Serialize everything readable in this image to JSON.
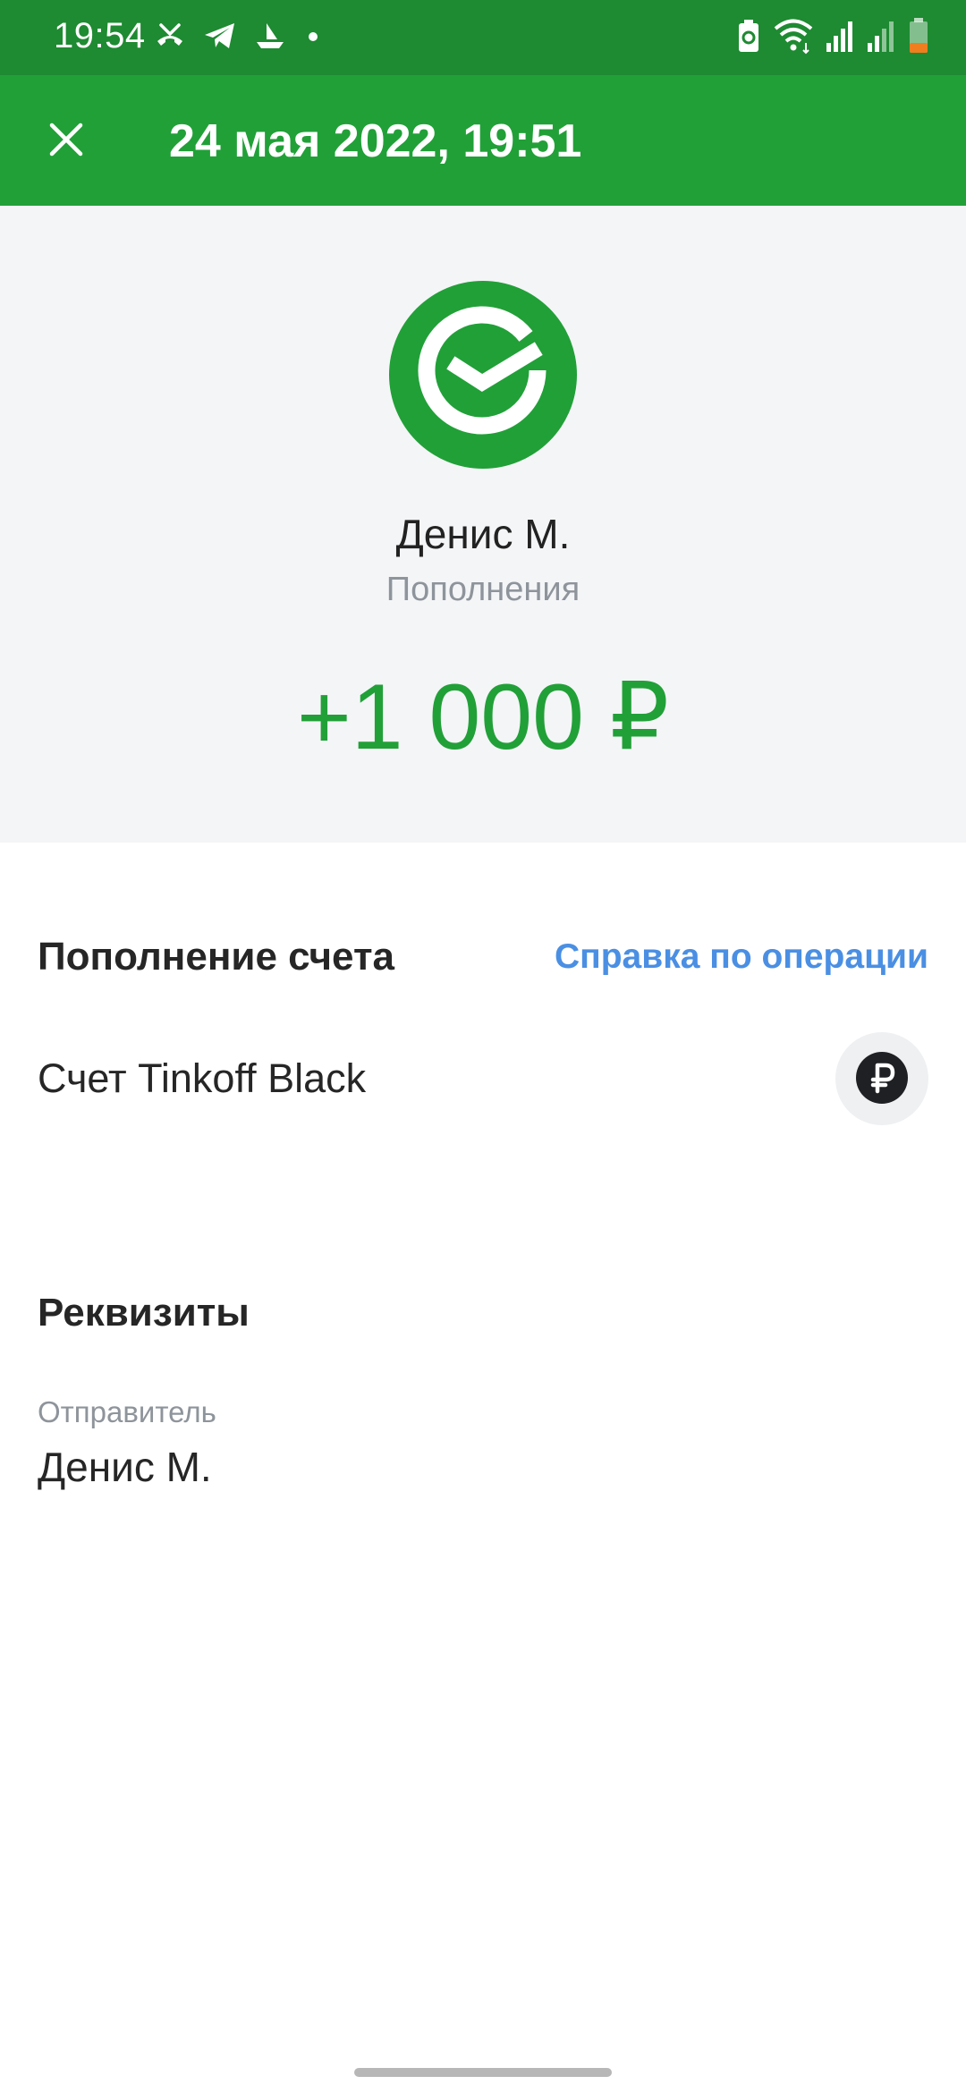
{
  "status_bar": {
    "time": "19:54",
    "left_icons": [
      "missed-call-icon",
      "telegram-icon",
      "boat-notification-icon",
      "notification-dot-icon"
    ],
    "right_icons": [
      "battery-saver-icon",
      "wifi-icon",
      "signal-1-icon",
      "signal-2-icon",
      "battery-icon"
    ]
  },
  "toolbar": {
    "title": "24 мая 2022, 19:51",
    "close_icon": "close-icon"
  },
  "hero": {
    "logo_icon": "sber-logo-icon",
    "name": "Денис М.",
    "category": "Пополнения",
    "amount": "+1 000 ₽"
  },
  "operation": {
    "title": "Пополнение счета",
    "help_link": "Справка по операции",
    "account_label": "Счет Tinkoff Black",
    "account_icon": "ruble-icon"
  },
  "details": {
    "title": "Реквизиты",
    "sender_label": "Отправитель",
    "sender_value": "Денис М."
  },
  "colors": {
    "status_bar": "#1e8a32",
    "toolbar": "#21a038",
    "amount": "#21a038",
    "link": "#4a8fe3",
    "hero_background": "#f4f5f7"
  }
}
